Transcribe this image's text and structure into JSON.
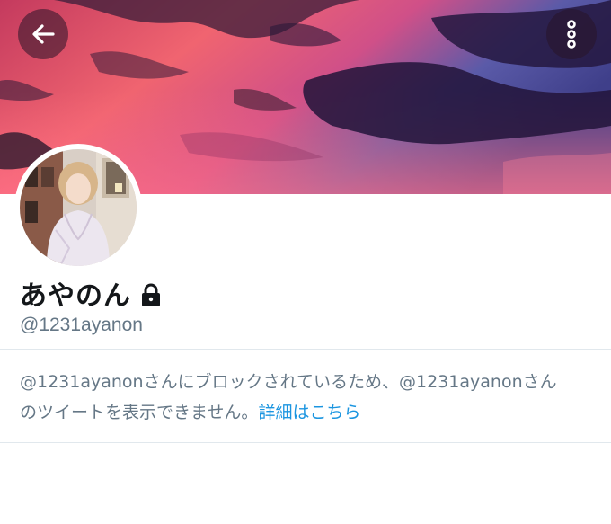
{
  "profile": {
    "display_name": "あやのん",
    "handle": "@1231ayanon",
    "protected": true
  },
  "notice": {
    "line1": "@1231ayanonさんにブロックされているため、@1231ayanonさん",
    "line2": "のツイートを表示できません。",
    "learn_more_label": "詳細はこちら"
  },
  "header": {
    "back_icon": "arrow-left-icon",
    "more_icon": "more-vertical-icon"
  },
  "colors": {
    "link": "#1b95e0",
    "secondary_text": "#657786",
    "primary_text": "#14171a",
    "divider": "#e1e8ed"
  }
}
